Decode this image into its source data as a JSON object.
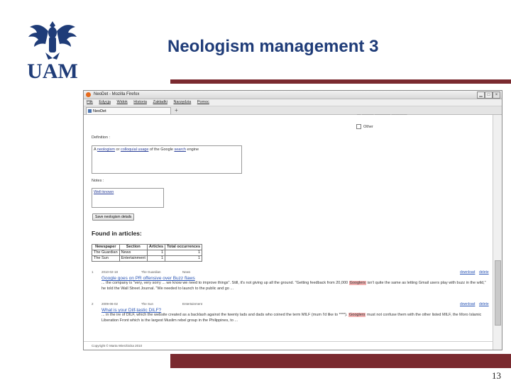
{
  "slide": {
    "logo_text": "UAM",
    "title": "Neologism management 3",
    "page_number": "13",
    "accent_color": "#7a2a2f",
    "title_color": "#1f3c78"
  },
  "browser": {
    "window_title": "NeoDet - Mozilla Firefox",
    "menu": [
      "Plik",
      "Edycja",
      "Widok",
      "Historia",
      "Zakładki",
      "Narzędzia",
      "Pomoc"
    ],
    "tab_label": "NeoDet",
    "new_tab": "+",
    "controls": {
      "minimize": "▁",
      "maximize": "□",
      "close": "×"
    }
  },
  "page": {
    "partial_option": "Other",
    "definition_label": "Definition :",
    "definition_text": {
      "prefix": "A ",
      "link1": "neologism",
      "mid1": " or ",
      "link2": "colloquial usage",
      "mid2": " of the Google ",
      "link3": "search",
      "suffix": " engine"
    },
    "notes_label": "Notes :",
    "notes_value": "Well-known",
    "save_button": "Save neologism details",
    "found_heading": "Found in articles:",
    "table_headers": [
      "Newspaper",
      "Section",
      "Articles",
      "Total occurrences"
    ],
    "table_rows": [
      [
        "The Guardian",
        "News",
        "1",
        "1"
      ],
      [
        "The Sun",
        "Entertainment",
        "1",
        "1"
      ]
    ],
    "articles": [
      {
        "num": "1",
        "date": "2010-02-18",
        "paper": "The Guardian",
        "section": "News",
        "title": "Google goes on PR offensive over Buzz flaws",
        "snippet_pre": "... the company is \"very, very sorry ... we know we need to improve things\". Still, it's not giving up all the ground. \"Getting feedback from 20,000 ",
        "snippet_hl": "Googlers",
        "snippet_post": " isn't quite the same as letting Gmail users play with buzz in the wild,\" he told the Wall Street Journal. \"We needed to launch to the public and go ...",
        "download": "download",
        "delete": "delete"
      },
      {
        "num": "2",
        "date": "2009-06-02",
        "paper": "The Sun",
        "section": "Entertainment",
        "title": "What is your Dilf-tastic DILF?",
        "snippet_pre": "... in the ire of DILF, which the website created as a backlash against the twenty lads and dads who coined the term MILF (mum I'd like to ****). ",
        "snippet_hl": "Googlers",
        "snippet_post": " must not confuse them with the other listed MILF, the Moro Islamic Liberation Front which is the largest Muslim rebel group in the Philippines, to ...",
        "download": "download",
        "delete": "delete"
      }
    ],
    "footer": "Copyright © Marta Wierzbicka 2010"
  }
}
